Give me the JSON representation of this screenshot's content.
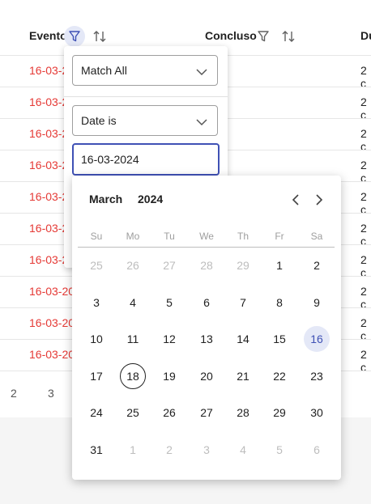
{
  "table": {
    "headers": {
      "evento": "Evento",
      "concluso": "Concluso",
      "durata": "Du"
    },
    "rows": [
      {
        "evento": "16-03-2",
        "durata": "2 c"
      },
      {
        "evento": "16-03-2",
        "durata": "2 c"
      },
      {
        "evento": "16-03-2",
        "durata": "2 c"
      },
      {
        "evento": "16-03-2",
        "durata": "2 c"
      },
      {
        "evento": "16-03-2",
        "durata": "2 c"
      },
      {
        "evento": "16-03-2",
        "durata": "2 c"
      },
      {
        "evento": "16-03-2",
        "durata": "2 c"
      },
      {
        "evento": "16-03-20",
        "durata": "2 c"
      },
      {
        "evento": "16-03-20",
        "durata": "2 c"
      },
      {
        "evento": "16-03-20",
        "durata": "2 c"
      }
    ],
    "pager": [
      "2",
      "3"
    ]
  },
  "filter": {
    "match_mode": "Match All",
    "condition": "Date is",
    "value": "16-03-2024"
  },
  "calendar": {
    "month": "March",
    "year": "2024",
    "weekdays": [
      "Su",
      "Mo",
      "Tu",
      "We",
      "Th",
      "Fr",
      "Sa"
    ],
    "weeks": [
      [
        {
          "d": "25",
          "m": true
        },
        {
          "d": "26",
          "m": true
        },
        {
          "d": "27",
          "m": true
        },
        {
          "d": "28",
          "m": true
        },
        {
          "d": "29",
          "m": true
        },
        {
          "d": "1"
        },
        {
          "d": "2"
        }
      ],
      [
        {
          "d": "3"
        },
        {
          "d": "4"
        },
        {
          "d": "5"
        },
        {
          "d": "6"
        },
        {
          "d": "7"
        },
        {
          "d": "8"
        },
        {
          "d": "9"
        }
      ],
      [
        {
          "d": "10"
        },
        {
          "d": "11"
        },
        {
          "d": "12"
        },
        {
          "d": "13"
        },
        {
          "d": "14"
        },
        {
          "d": "15"
        },
        {
          "d": "16",
          "sel": true
        }
      ],
      [
        {
          "d": "17"
        },
        {
          "d": "18",
          "today": true
        },
        {
          "d": "19"
        },
        {
          "d": "20"
        },
        {
          "d": "21"
        },
        {
          "d": "22"
        },
        {
          "d": "23"
        }
      ],
      [
        {
          "d": "24"
        },
        {
          "d": "25"
        },
        {
          "d": "26"
        },
        {
          "d": "27"
        },
        {
          "d": "28"
        },
        {
          "d": "29"
        },
        {
          "d": "30"
        }
      ],
      [
        {
          "d": "31"
        },
        {
          "d": "1",
          "m": true
        },
        {
          "d": "2",
          "m": true
        },
        {
          "d": "3",
          "m": true
        },
        {
          "d": "4",
          "m": true
        },
        {
          "d": "5",
          "m": true
        },
        {
          "d": "6",
          "m": true
        }
      ]
    ]
  },
  "colors": {
    "accent": "#3f51b5",
    "selected_bg": "#e4e8f7",
    "date_red": "#e53935"
  }
}
